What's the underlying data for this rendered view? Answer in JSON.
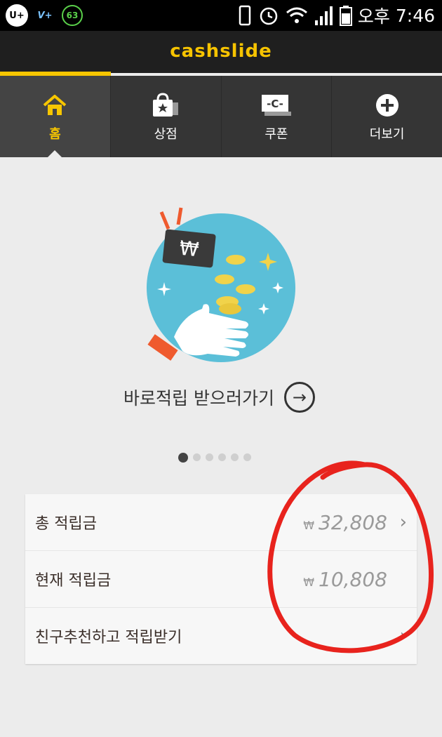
{
  "status_bar": {
    "carrier_icon": "U+",
    "volte_icon": "V+",
    "counter_badge": "63",
    "ampm": "오후",
    "time": "7:46"
  },
  "app": {
    "logo_text": "cashslide"
  },
  "tabs": [
    {
      "label": "홈",
      "icon": "home-icon",
      "active": true
    },
    {
      "label": "상점",
      "icon": "shopping-bag-icon",
      "active": false
    },
    {
      "label": "쿠폰",
      "icon": "coupon-icon",
      "active": false
    },
    {
      "label": "더보기",
      "icon": "plus-circle-icon",
      "active": false
    }
  ],
  "banner": {
    "cta_label": "바로적립 받으러가기",
    "arrow": "→",
    "won_symbol": "₩"
  },
  "pager": {
    "count": 6,
    "active_index": 0
  },
  "points": [
    {
      "label": "총 적립금",
      "currency": "₩",
      "value": "32,808",
      "chevron": "›"
    },
    {
      "label": "현재 적립금",
      "currency": "₩",
      "value": "10,808",
      "chevron": ""
    },
    {
      "label": "친구추천하고 적립받기",
      "currency": "",
      "value": "",
      "chevron": "›"
    }
  ],
  "colors": {
    "accent_yellow": "#f7c600",
    "hero_blue": "#5bbfd8",
    "annotation_red": "#e8231d"
  }
}
